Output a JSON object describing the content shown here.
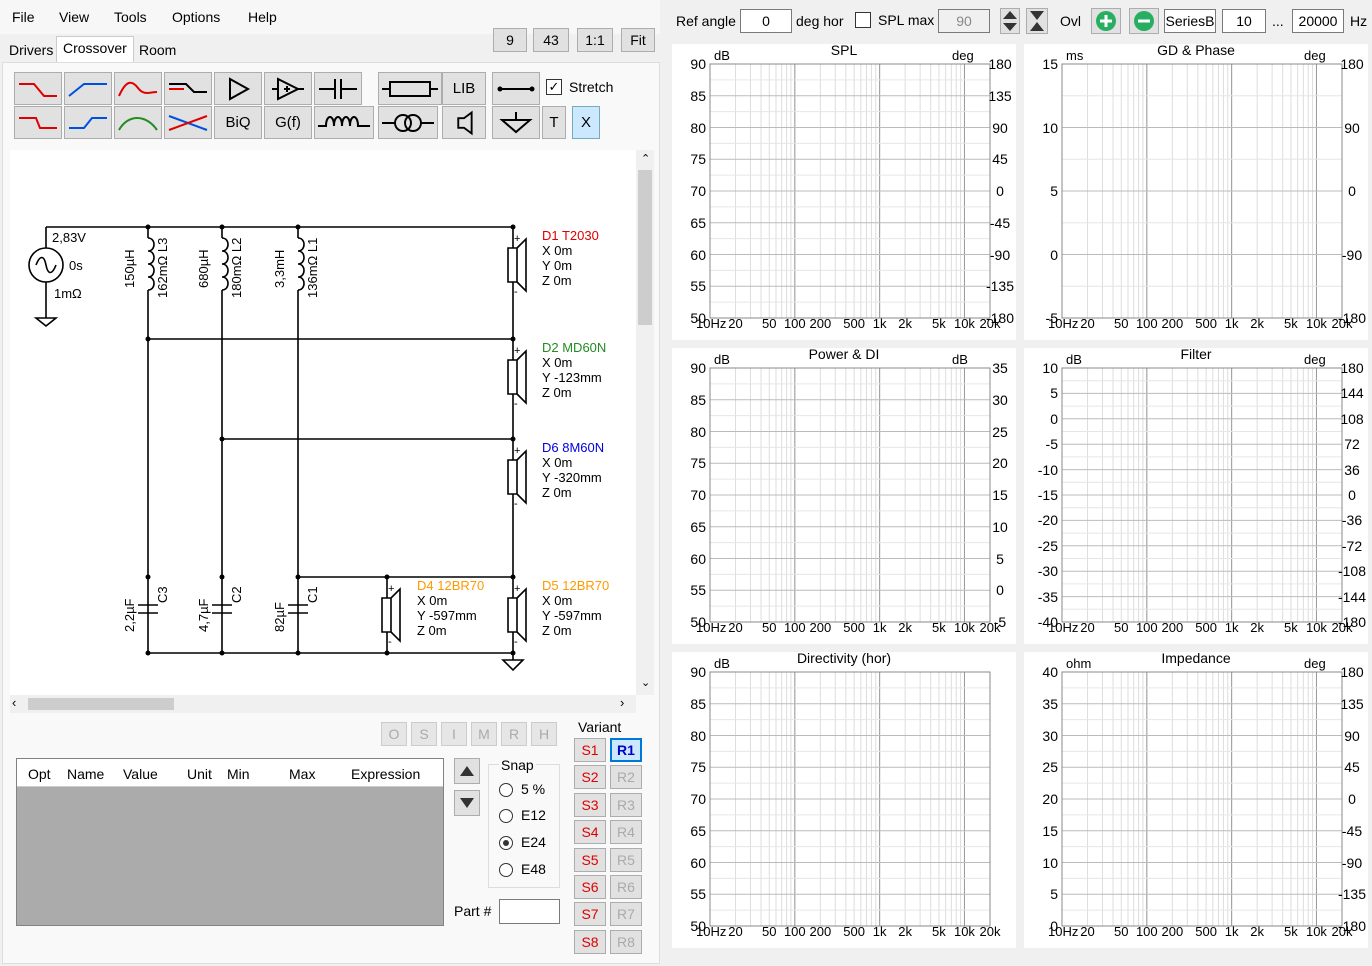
{
  "menu": [
    "File",
    "View",
    "Tools",
    "Options",
    "Help"
  ],
  "tabs": [
    "Drivers",
    "Crossover",
    "Room"
  ],
  "zoom_buttons": [
    "9",
    "43",
    "1:1",
    "Fit"
  ],
  "toolbar": {
    "lib": "LIB",
    "biq": "BiQ",
    "gf": "G(f)",
    "t": "T",
    "x": "X",
    "stretch": "Stretch"
  },
  "schematic": {
    "source": {
      "voltage": "2,83V",
      "delay": "0s",
      "resistance": "1mΩ"
    },
    "inductors": [
      {
        "value": "150µH",
        "name": "162mΩ L3"
      },
      {
        "value": "680µH",
        "name": "180mΩ L2"
      },
      {
        "value": "3,3mH",
        "name": "136mΩ L1"
      }
    ],
    "capacitors": [
      {
        "value": "2,2µF",
        "name": "C3"
      },
      {
        "value": "4,7µF",
        "name": "C2"
      },
      {
        "value": "82µF",
        "name": "C1"
      }
    ],
    "drivers": [
      {
        "name": "D1 T2030",
        "x": "X 0m",
        "y": "Y 0m",
        "z": "Z 0m",
        "color": "#e00000"
      },
      {
        "name": "D2 MD60N",
        "x": "X 0m",
        "y": "Y -123mm",
        "z": "Z 0m",
        "color": "#228b22"
      },
      {
        "name": "D6 8M60N",
        "x": "X 0m",
        "y": "Y -320mm",
        "z": "Z 0m",
        "color": "#0000e0"
      },
      {
        "name": "D4 12BR70",
        "x": "X 0m",
        "y": "Y -597mm",
        "z": "Z 0m",
        "color": "#ff9900"
      },
      {
        "name": "D5 12BR70",
        "x": "X 0m",
        "y": "Y -597mm",
        "z": "Z 0m",
        "color": "#ff9900"
      }
    ],
    "plus": "+",
    "minus": "-"
  },
  "opt_buttons": [
    "O",
    "S",
    "I",
    "M",
    "R",
    "H"
  ],
  "params_table": {
    "columns": [
      "Opt",
      "Name",
      "Value",
      "Unit",
      "Min",
      "Max",
      "Expression"
    ]
  },
  "snap": {
    "label": "Snap",
    "options": [
      "5 %",
      "E12",
      "E24",
      "E48"
    ],
    "selected": "E24"
  },
  "part_label": "Part #",
  "variant": {
    "label": "Variant",
    "s": [
      "S1",
      "S2",
      "S3",
      "S4",
      "S5",
      "S6",
      "S7",
      "S8"
    ],
    "r": [
      "R1",
      "R2",
      "R3",
      "R4",
      "R5",
      "R6",
      "R7",
      "R8"
    ],
    "active_r": "R1"
  },
  "top_controls": {
    "ref_angle_label": "Ref angle",
    "ref_angle": "0",
    "deg_hor": "deg hor",
    "spl_max": "SPL max",
    "spl_max_value": "90",
    "ovl": "Ovl",
    "series": "SeriesB",
    "f_low": "10",
    "ellipsis": "...",
    "f_high": "20000",
    "hz": "Hz"
  },
  "x_ticks": [
    "10Hz",
    "20",
    "50",
    "100",
    "200",
    "500",
    "1k",
    "2k",
    "5k",
    "10k",
    "20k"
  ],
  "charts": [
    {
      "title": "SPL",
      "left_unit": "dB",
      "right_unit": "deg",
      "left": [
        "90",
        "85",
        "80",
        "75",
        "70",
        "65",
        "60",
        "55",
        "50"
      ],
      "right": [
        "180",
        "135",
        "90",
        "45",
        "0",
        "-45",
        "-90",
        "-135",
        "-180"
      ]
    },
    {
      "title": "GD & Phase",
      "left_unit": "ms",
      "right_unit": "deg",
      "left": [
        "15",
        "10",
        "5",
        "0",
        "-5"
      ],
      "right": [
        "180",
        "90",
        "0",
        "-90",
        "-180"
      ]
    },
    {
      "title": "Power & DI",
      "left_unit": "dB",
      "right_unit": "dB",
      "left": [
        "90",
        "85",
        "80",
        "75",
        "70",
        "65",
        "60",
        "55",
        "50"
      ],
      "right": [
        "35",
        "30",
        "25",
        "20",
        "15",
        "10",
        "5",
        "0",
        "-5"
      ]
    },
    {
      "title": "Filter",
      "left_unit": "dB",
      "right_unit": "deg",
      "left": [
        "10",
        "5",
        "0",
        "-5",
        "-10",
        "-15",
        "-20",
        "-25",
        "-30",
        "-35",
        "-40"
      ],
      "right": [
        "180",
        "144",
        "108",
        "72",
        "36",
        "0",
        "-36",
        "-72",
        "-108",
        "-144",
        "-180"
      ]
    },
    {
      "title": "Directivity (hor)",
      "left_unit": "dB",
      "right_unit": "",
      "left": [
        "90",
        "85",
        "80",
        "75",
        "70",
        "65",
        "60",
        "55",
        "50"
      ],
      "right": []
    },
    {
      "title": "Impedance",
      "left_unit": "ohm",
      "right_unit": "deg",
      "left": [
        "40",
        "35",
        "30",
        "25",
        "20",
        "15",
        "10",
        "5",
        "0"
      ],
      "right": [
        "180",
        "135",
        "90",
        "45",
        "0",
        "-45",
        "-90",
        "-135",
        "-180"
      ]
    }
  ]
}
